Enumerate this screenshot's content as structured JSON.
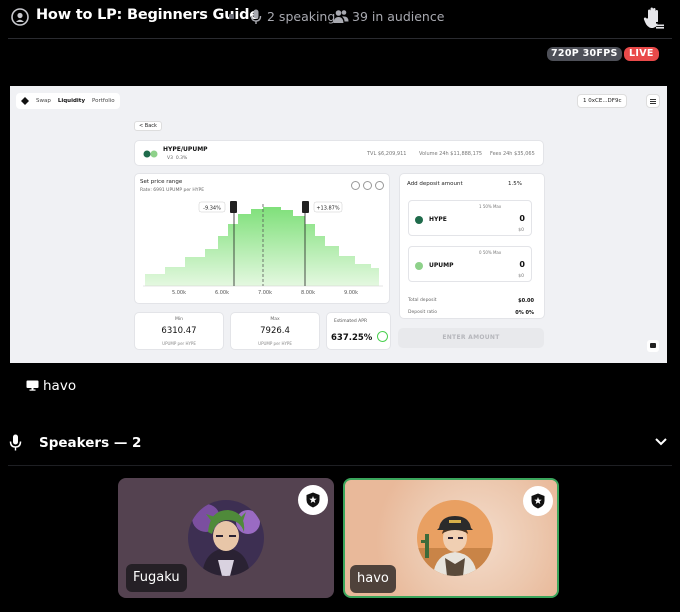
{
  "header": {
    "title": "How to LP: Beginners Guide",
    "speaking": "2 speaking",
    "audience": "39 in audience"
  },
  "badges": {
    "quality": "720P 30FPS",
    "live": "LIVE"
  },
  "stream": {
    "streamer": "havo",
    "nav": [
      "Swap",
      "Liquidity",
      "Portfolio"
    ],
    "wallet": "1 0xCE...DF9c",
    "back": "< Back",
    "pair": {
      "name": "HYPE/UPUMP",
      "version": "V3",
      "fee": "0.3%",
      "tvl": "TVL $6,209,911",
      "volume": "Volume 24h $11,888,175",
      "fees": "Fees 24h $35,065"
    },
    "range": {
      "title": "Set price range",
      "rate": "Rate: 6991 UPUMP per HYPE",
      "left_pct": "-9.34%",
      "right_pct": "+13.87%",
      "ticks": [
        "5.00k",
        "6.00k",
        "7.00k",
        "8.00k",
        "9.00k"
      ]
    },
    "deposit": {
      "title": "Add deposit amount",
      "slippage": "1.5%",
      "tokens": [
        {
          "name": "HYPE",
          "amount": "0",
          "usd": "$0",
          "tags": "1  50%  Max"
        },
        {
          "name": "UPUMP",
          "amount": "0",
          "usd": "$0",
          "tags": "0  50%  Max"
        }
      ],
      "total_label": "Total deposit",
      "total_value": "$0.00",
      "ratio_label": "Deposit ratio",
      "ratio_value": "0%   0%"
    },
    "min": {
      "label": "Min",
      "value": "6310.47",
      "unit": "UPUMP per HYPE"
    },
    "max": {
      "label": "Max",
      "value": "7926.4",
      "unit": "UPUMP per HYPE"
    },
    "apr": {
      "label": "Estimated APR",
      "value": "637.25%"
    },
    "enter": "ENTER AMOUNT"
  },
  "speakers": {
    "title": "Speakers — 2",
    "list": [
      {
        "name": "Fugaku"
      },
      {
        "name": "havo"
      }
    ]
  },
  "colors": {
    "live": "#e94a4a",
    "speaking_border": "#3ba55c",
    "tile_fugaku": "#544250",
    "tile_havo": "#e9b99a"
  }
}
